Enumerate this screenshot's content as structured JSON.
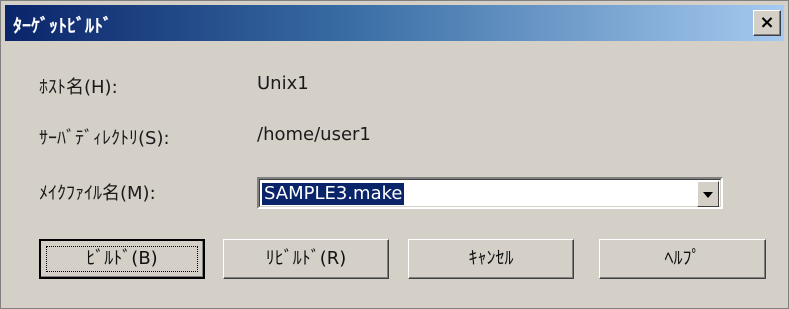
{
  "window": {
    "title": "ﾀｰｹﾞｯﾄﾋﾞﾙﾄﾞ",
    "close_label": "×"
  },
  "fields": {
    "host_label": "ﾎｽﾄ名(H):",
    "host_value": "Unix1",
    "server_dir_label": "ｻｰﾊﾞﾃﾞｨﾚｸﾄﾘ(S):",
    "server_dir_value": "/home/user1",
    "makefile_label": "ﾒｲｸﾌｧｲﾙ名(M):",
    "makefile_value": "SAMPLE3.make"
  },
  "buttons": {
    "build": "ﾋﾞﾙﾄﾞ(B)",
    "rebuild": "ﾘﾋﾞﾙﾄﾞ(R)",
    "cancel": "ｷｬﾝｾﾙ",
    "help": "ﾍﾙﾌﾟ"
  },
  "colors": {
    "titlebar_start": "#0a246a",
    "titlebar_end": "#a6caf0",
    "face": "#d4d0c8",
    "selection": "#0a246a"
  }
}
